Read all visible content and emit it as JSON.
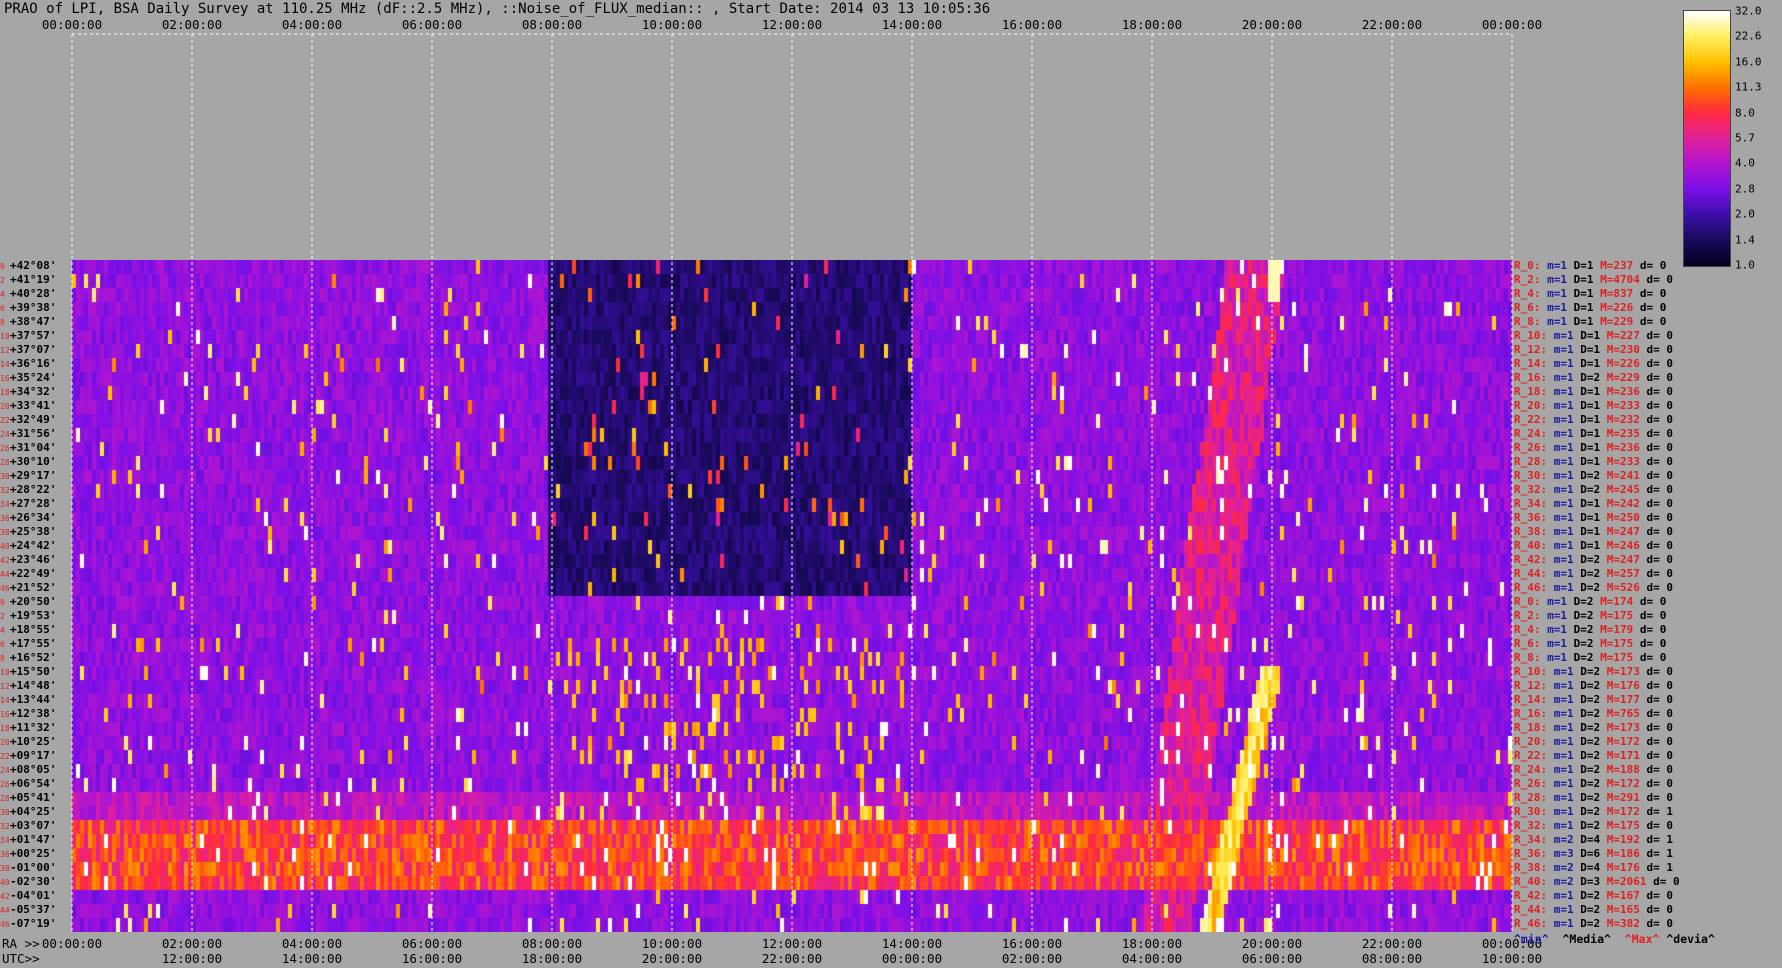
{
  "title": "PRAO of LPI, BSA Daily Survey at 110.25 MHz (dF::2.5 MHz), ::Noise_of_FLUX_median:: , Start Date: 2014 03 13 10:05:36",
  "axis": {
    "ra_label": "RA >>",
    "utc_label": "UTC>>",
    "ra_ticks": [
      "00:00:00",
      "02:00:00",
      "04:00:00",
      "06:00:00",
      "08:00:00",
      "10:00:00",
      "12:00:00",
      "14:00:00",
      "16:00:00",
      "18:00:00",
      "20:00:00",
      "22:00:00",
      "00:00:00"
    ],
    "utc_ticks": [
      "12:00:00",
      "14:00:00",
      "16:00:00",
      "18:00:00",
      "20:00:00",
      "22:00:00",
      "00:00:00",
      "02:00:00",
      "04:00:00",
      "06:00:00",
      "08:00:00",
      "10:00:00"
    ]
  },
  "declinations": [
    "+42°08'",
    "+41°19'",
    "+40°28'",
    "+39°38'",
    "+38°47'",
    "+37°57'",
    "+37°07'",
    "+36°16'",
    "+35°24'",
    "+34°32'",
    "+33°41'",
    "+32°49'",
    "+31°56'",
    "+31°04'",
    "+30°10'",
    "+29°17'",
    "+28°22'",
    "+27°28'",
    "+26°34'",
    "+25°38'",
    "+24°42'",
    "+23°46'",
    "+22°49'",
    "+21°52'",
    "+20°50'",
    "+19°53'",
    "+18°55'",
    "+17°55'",
    "+16°52'",
    "+15°50'",
    "+14°48'",
    "+13°44'",
    "+12°38'",
    "+11°32'",
    "+10°25'",
    "+09°17'",
    "+08°05'",
    "+06°54'",
    "+05°41'",
    "+04°25'",
    "+03°07'",
    "+01°47'",
    "+00°25'",
    "-01°00'",
    "-02°30'",
    "-04°01'",
    "-05°37'",
    "-07°19'"
  ],
  "row_index": [
    "0",
    "2",
    "4",
    "6",
    "8",
    "10",
    "12",
    "14",
    "16",
    "18",
    "20",
    "22",
    "24",
    "26",
    "28",
    "30",
    "32",
    "34",
    "36",
    "38",
    "40",
    "42",
    "44",
    "46",
    "0",
    "2",
    "4",
    "6",
    "8",
    "10",
    "12",
    "14",
    "16",
    "18",
    "20",
    "22",
    "24",
    "26",
    "28",
    "30",
    "32",
    "34",
    "36",
    "38",
    "40",
    "42",
    "44",
    "46"
  ],
  "stats": [
    {
      "r": "R_0:",
      "m": "m=1",
      "d": "D=1",
      "x": "M=237",
      "dev": "d= 0"
    },
    {
      "r": "R_2:",
      "m": "m=1",
      "d": "D=1",
      "x": "M=4704",
      "dev": "d= 0"
    },
    {
      "r": "R_4:",
      "m": "m=1",
      "d": "D=1",
      "x": "M=837",
      "dev": "d= 0"
    },
    {
      "r": "R_6:",
      "m": "m=1",
      "d": "D=1",
      "x": "M=226",
      "dev": "d= 0"
    },
    {
      "r": "R_8:",
      "m": "m=1",
      "d": "D=1",
      "x": "M=229",
      "dev": "d= 0"
    },
    {
      "r": "R_10:",
      "m": "m=1",
      "d": "D=1",
      "x": "M=227",
      "dev": "d= 0"
    },
    {
      "r": "R_12:",
      "m": "m=1",
      "d": "D=1",
      "x": "M=230",
      "dev": "d= 0"
    },
    {
      "r": "R_14:",
      "m": "m=1",
      "d": "D=1",
      "x": "M=226",
      "dev": "d= 0"
    },
    {
      "r": "R_16:",
      "m": "m=1",
      "d": "D=2",
      "x": "M=229",
      "dev": "d= 0"
    },
    {
      "r": "R_18:",
      "m": "m=1",
      "d": "D=1",
      "x": "M=236",
      "dev": "d= 0"
    },
    {
      "r": "R_20:",
      "m": "m=1",
      "d": "D=1",
      "x": "M=233",
      "dev": "d= 0"
    },
    {
      "r": "R_22:",
      "m": "m=1",
      "d": "D=1",
      "x": "M=232",
      "dev": "d= 0"
    },
    {
      "r": "R_24:",
      "m": "m=1",
      "d": "D=1",
      "x": "M=235",
      "dev": "d= 0"
    },
    {
      "r": "R_26:",
      "m": "m=1",
      "d": "D=1",
      "x": "M=236",
      "dev": "d= 0"
    },
    {
      "r": "R_28:",
      "m": "m=1",
      "d": "D=1",
      "x": "M=233",
      "dev": "d= 0"
    },
    {
      "r": "R_30:",
      "m": "m=1",
      "d": "D=2",
      "x": "M=241",
      "dev": "d= 0"
    },
    {
      "r": "R_32:",
      "m": "m=1",
      "d": "D=2",
      "x": "M=245",
      "dev": "d= 0"
    },
    {
      "r": "R_34:",
      "m": "m=1",
      "d": "D=1",
      "x": "M=242",
      "dev": "d= 0"
    },
    {
      "r": "R_36:",
      "m": "m=1",
      "d": "D=1",
      "x": "M=250",
      "dev": "d= 0"
    },
    {
      "r": "R_38:",
      "m": "m=1",
      "d": "D=1",
      "x": "M=247",
      "dev": "d= 0"
    },
    {
      "r": "R_40:",
      "m": "m=1",
      "d": "D=1",
      "x": "M=246",
      "dev": "d= 0"
    },
    {
      "r": "R_42:",
      "m": "m=1",
      "d": "D=2",
      "x": "M=247",
      "dev": "d= 0"
    },
    {
      "r": "R_44:",
      "m": "m=1",
      "d": "D=2",
      "x": "M=257",
      "dev": "d= 0"
    },
    {
      "r": "R_46:",
      "m": "m=1",
      "d": "D=2",
      "x": "M=526",
      "dev": "d= 0"
    },
    {
      "r": "R_0:",
      "m": "m=1",
      "d": "D=2",
      "x": "M=174",
      "dev": "d= 0"
    },
    {
      "r": "R_2:",
      "m": "m=1",
      "d": "D=2",
      "x": "M=175",
      "dev": "d= 0"
    },
    {
      "r": "R_4:",
      "m": "m=1",
      "d": "D=2",
      "x": "M=179",
      "dev": "d= 0"
    },
    {
      "r": "R_6:",
      "m": "m=1",
      "d": "D=2",
      "x": "M=175",
      "dev": "d= 0"
    },
    {
      "r": "R_8:",
      "m": "m=1",
      "d": "D=2",
      "x": "M=175",
      "dev": "d= 0"
    },
    {
      "r": "R_10:",
      "m": "m=1",
      "d": "D=2",
      "x": "M=173",
      "dev": "d= 0"
    },
    {
      "r": "R_12:",
      "m": "m=1",
      "d": "D=2",
      "x": "M=176",
      "dev": "d= 0"
    },
    {
      "r": "R_14:",
      "m": "m=1",
      "d": "D=2",
      "x": "M=177",
      "dev": "d= 0"
    },
    {
      "r": "R_16:",
      "m": "m=1",
      "d": "D=2",
      "x": "M=765",
      "dev": "d= 0"
    },
    {
      "r": "R_18:",
      "m": "m=1",
      "d": "D=2",
      "x": "M=173",
      "dev": "d= 0"
    },
    {
      "r": "R_20:",
      "m": "m=1",
      "d": "D=2",
      "x": "M=172",
      "dev": "d= 0"
    },
    {
      "r": "R_22:",
      "m": "m=1",
      "d": "D=2",
      "x": "M=171",
      "dev": "d= 0"
    },
    {
      "r": "R_24:",
      "m": "m=1",
      "d": "D=2",
      "x": "M=188",
      "dev": "d= 0"
    },
    {
      "r": "R_26:",
      "m": "m=1",
      "d": "D=2",
      "x": "M=172",
      "dev": "d= 0"
    },
    {
      "r": "R_28:",
      "m": "m=1",
      "d": "D=2",
      "x": "M=291",
      "dev": "d= 0"
    },
    {
      "r": "R_30:",
      "m": "m=1",
      "d": "D=2",
      "x": "M=172",
      "dev": "d= 1"
    },
    {
      "r": "R_32:",
      "m": "m=1",
      "d": "D=2",
      "x": "M=175",
      "dev": "d= 0"
    },
    {
      "r": "R_34:",
      "m": "m=2",
      "d": "D=4",
      "x": "M=192",
      "dev": "d= 1"
    },
    {
      "r": "R_36:",
      "m": "m=3",
      "d": "D=6",
      "x": "M=186",
      "dev": "d= 1"
    },
    {
      "r": "R_38:",
      "m": "m=2",
      "d": "D=4",
      "x": "M=176",
      "dev": "d= 1"
    },
    {
      "r": "R_40:",
      "m": "m=2",
      "d": "D=3",
      "x": "M=2061",
      "dev": "d= 0"
    },
    {
      "r": "R_42:",
      "m": "m=1",
      "d": "D=2",
      "x": "M=167",
      "dev": "d= 0"
    },
    {
      "r": "R_44:",
      "m": "m=1",
      "d": "D=2",
      "x": "M=165",
      "dev": "d= 0"
    },
    {
      "r": "R_46:",
      "m": "m=1",
      "d": "D=2",
      "x": "M=382",
      "dev": "d= 0"
    }
  ],
  "legend": {
    "min": "^min^",
    "median": "^Media^",
    "max": "^Max^",
    "dev": "^devia^"
  },
  "colorbar": {
    "ticks": [
      "32.0",
      "22.6",
      "16.0",
      "11.3",
      "8.0",
      "5.7",
      "4.0",
      "2.8",
      "2.0",
      "1.4",
      "1.0"
    ],
    "colors": [
      "#000020",
      "#1a0a5a",
      "#3a0fa8",
      "#7a10e8",
      "#b015d0",
      "#e0209a",
      "#ff2a40",
      "#ff7000",
      "#ffc000",
      "#fff060",
      "#ffffff"
    ]
  },
  "chart_data": {
    "type": "heatmap",
    "x_axis": "RA 00:00:00 - 24:00:00 (UTC 10:05 - 10:05 next day)",
    "y_axis": "Declination +42°08' to -07°19', 48 beams",
    "scale": "log, 1.0 - 32.0",
    "features": [
      {
        "description": "bright source near zenith beams",
        "ra": "20:00:00",
        "dec": "+40°28'",
        "value": 32.0
      },
      {
        "description": "broad enhanced band around celestial equator",
        "dec_range": [
          "+03°07'",
          "-02°30'"
        ],
        "value": 8.0
      },
      {
        "description": "Sun drift trace",
        "ra_range": [
          "18:30:00",
          "20:00:00"
        ],
        "value": 16.0
      },
      {
        "description": "Dark quiet region",
        "ra_range": [
          "08:00:00",
          "14:00:00"
        ],
        "dec_range": [
          "+42°08'",
          "+22°49'"
        ],
        "value": 1.0
      }
    ]
  }
}
